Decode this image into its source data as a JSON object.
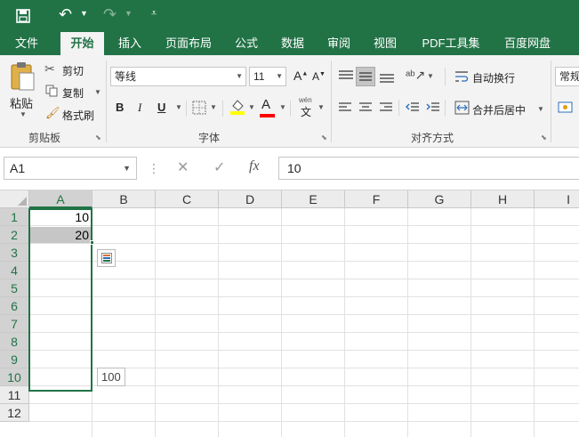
{
  "quick_access": {
    "save_icon": "save-icon",
    "undo_icon": "undo-icon",
    "redo_icon": "redo-icon",
    "customize_icon": "customize-icon"
  },
  "tabs": [
    {
      "label": "文件"
    },
    {
      "label": "开始",
      "active": true
    },
    {
      "label": "插入"
    },
    {
      "label": "页面布局"
    },
    {
      "label": "公式"
    },
    {
      "label": "数据"
    },
    {
      "label": "审阅"
    },
    {
      "label": "视图"
    },
    {
      "label": "PDF工具集"
    },
    {
      "label": "百度网盘"
    }
  ],
  "ribbon": {
    "clipboard": {
      "paste_label": "粘贴",
      "cut_label": "剪切",
      "copy_label": "复制",
      "format_painter_label": "格式刷",
      "group_label": "剪贴板"
    },
    "font": {
      "font_name": "等线",
      "font_size": "11",
      "bold_label": "B",
      "italic_label": "I",
      "underline_label": "U",
      "font_color_label": "A",
      "group_label": "字体",
      "increase_label": "A",
      "decrease_label": "A",
      "phonetic_label": "wén",
      "phonetic_char": "文",
      "fill_color": "#ffff00",
      "font_color": "#ff0000"
    },
    "alignment": {
      "wrap_label": "自动换行",
      "merge_label": "合并后居中",
      "group_label": "对齐方式"
    },
    "number": {
      "format_value": "常规"
    }
  },
  "formula_bar": {
    "name_box": "A1",
    "cancel_icon": "✕",
    "enter_icon": "✓",
    "fx_label": "fx",
    "value": "10"
  },
  "sheet": {
    "columns": [
      "A",
      "B",
      "C",
      "D",
      "E",
      "F",
      "G",
      "H",
      "I"
    ],
    "rows": [
      "1",
      "2",
      "3",
      "4",
      "5",
      "6",
      "7",
      "8",
      "9",
      "10",
      "11",
      "12"
    ],
    "cells": {
      "A1": "10",
      "A2": "20"
    },
    "fill_tooltip": "100"
  },
  "colors": {
    "accent": "#217346",
    "ribbon_bg": "#f3f3f3",
    "header_bg": "#ececec"
  }
}
